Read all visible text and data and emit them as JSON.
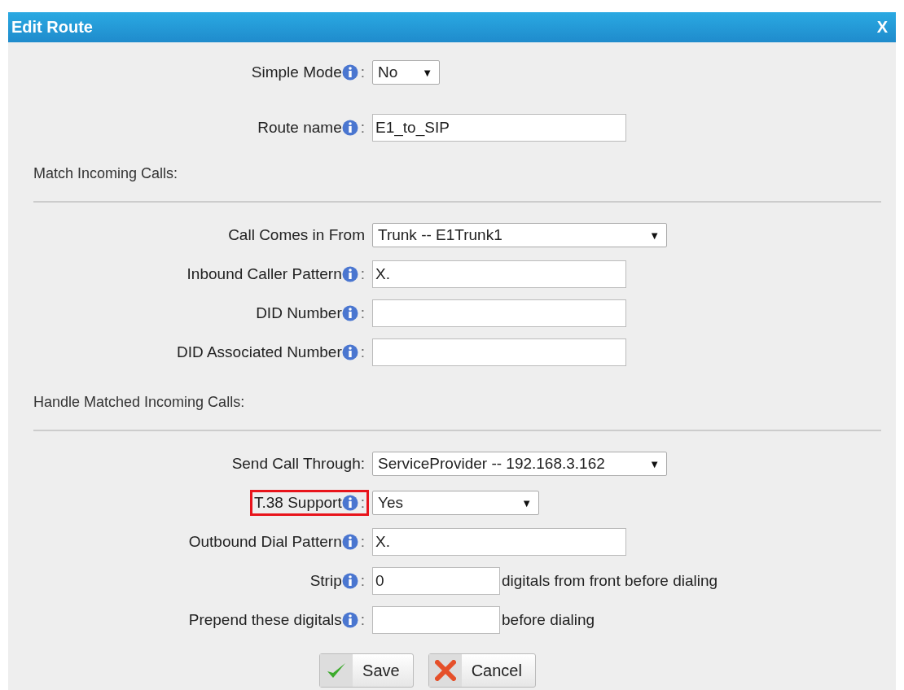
{
  "window": {
    "title": "Edit Route",
    "close": "X"
  },
  "top_fields": [
    {
      "label": "Simple Mode",
      "info": true,
      "colon": ":",
      "kind": "short-select",
      "value": "No",
      "arrow": "▼"
    },
    {
      "label": "Route name",
      "info": true,
      "colon": ":",
      "kind": "text",
      "value": "E1_to_SIP"
    }
  ],
  "sections": [
    {
      "heading": "Match Incoming Calls:",
      "fields": [
        {
          "label": "Call Comes in From",
          "info": false,
          "kind": "wide-select",
          "value": "Trunk -- E1Trunk1",
          "arrow": "▼"
        },
        {
          "label": "Inbound Caller Pattern",
          "info": true,
          "colon": ":",
          "kind": "text",
          "value": "X."
        },
        {
          "label": "DID Number",
          "info": true,
          "colon": ":",
          "kind": "text"
        },
        {
          "label": "DID Associated Number",
          "info": true,
          "colon": ":",
          "kind": "text"
        }
      ]
    },
    {
      "heading": "Handle Matched Incoming Calls:",
      "fields": [
        {
          "label": "Send Call Through:",
          "info": false,
          "kind": "wide-select",
          "value": "ServiceProvider -- 192.168.3.162",
          "arrow": "▼"
        },
        {
          "label": "T.38 Support",
          "info": true,
          "colon": ":",
          "kind": "select",
          "value": "Yes",
          "arrow": "▼",
          "highlighted": true
        },
        {
          "label": "Outbound Dial Pattern",
          "info": true,
          "colon": ":",
          "kind": "text",
          "value": "X."
        },
        {
          "label": "Strip",
          "info": true,
          "colon": ":",
          "kind": "short-text",
          "value": "0",
          "after": "digitals from front before dialing"
        },
        {
          "label": "Prepend these digitals",
          "info": true,
          "colon": ":",
          "kind": "short-text",
          "after": "before dialing"
        }
      ]
    }
  ],
  "buttons": [
    {
      "kind": "save",
      "label": "Save"
    },
    {
      "kind": "cancel",
      "label": "Cancel"
    }
  ]
}
